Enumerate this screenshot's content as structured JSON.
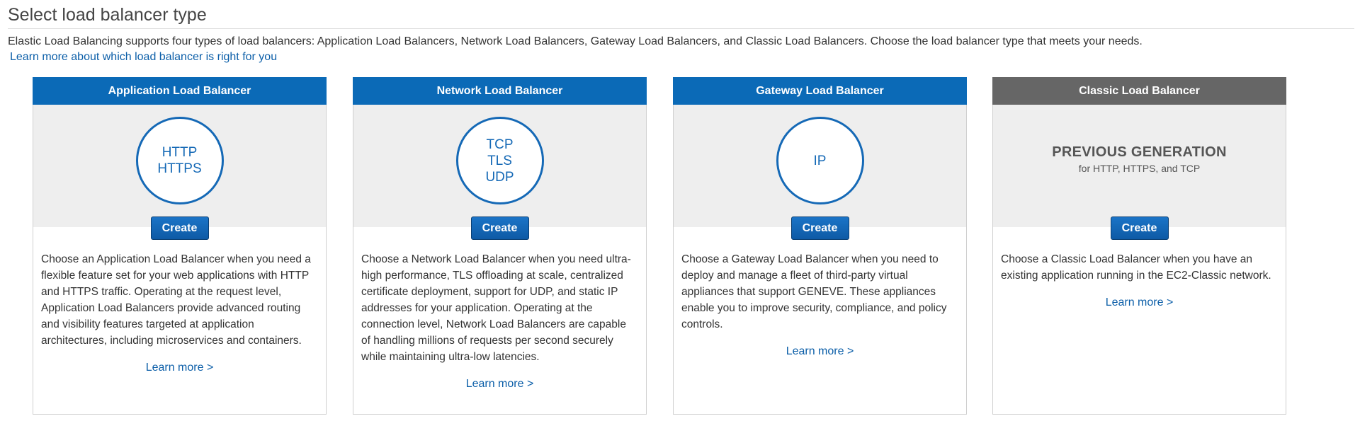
{
  "page": {
    "title": "Select load balancer type",
    "intro": "Elastic Load Balancing supports four types of load balancers: Application Load Balancers, Network Load Balancers, Gateway Load Balancers, and Classic Load Balancers. Choose the load balancer type that meets your needs.",
    "intro_link": "Learn more about which load balancer is right for you"
  },
  "colors": {
    "header_blue": "#0b6ab7",
    "header_gray": "#666666",
    "link_blue": "#0b5ea8",
    "circle_blue": "#1569b6"
  },
  "cards": [
    {
      "title": "Application Load Balancer",
      "protocols": [
        "HTTP",
        "HTTPS"
      ],
      "create_label": "Create",
      "description": "Choose an Application Load Balancer when you need a flexible feature set for your web applications with HTTP and HTTPS traffic. Operating at the request level, Application Load Balancers provide advanced routing and visibility features targeted at application architectures, including microservices and containers.",
      "learn_more": "Learn more >"
    },
    {
      "title": "Network Load Balancer",
      "protocols": [
        "TCP",
        "TLS",
        "UDP"
      ],
      "create_label": "Create",
      "description": "Choose a Network Load Balancer when you need ultra-high performance, TLS offloading at scale, centralized certificate deployment, support for UDP, and static IP addresses for your application. Operating at the connection level, Network Load Balancers are capable of handling millions of requests per second securely while maintaining ultra-low latencies.",
      "learn_more": "Learn more >"
    },
    {
      "title": "Gateway Load Balancer",
      "protocols": [
        "IP"
      ],
      "create_label": "Create",
      "description": "Choose a Gateway Load Balancer when you need to deploy and manage a fleet of third-party virtual appliances that support GENEVE. These appliances enable you to improve security, compliance, and policy controls.",
      "learn_more": "Learn more >"
    },
    {
      "title": "Classic Load Balancer",
      "badge_title": "PREVIOUS GENERATION",
      "badge_subtitle": "for HTTP, HTTPS, and TCP",
      "create_label": "Create",
      "description": "Choose a Classic Load Balancer when you have an existing application running in the EC2-Classic network.",
      "learn_more": "Learn more >"
    }
  ]
}
